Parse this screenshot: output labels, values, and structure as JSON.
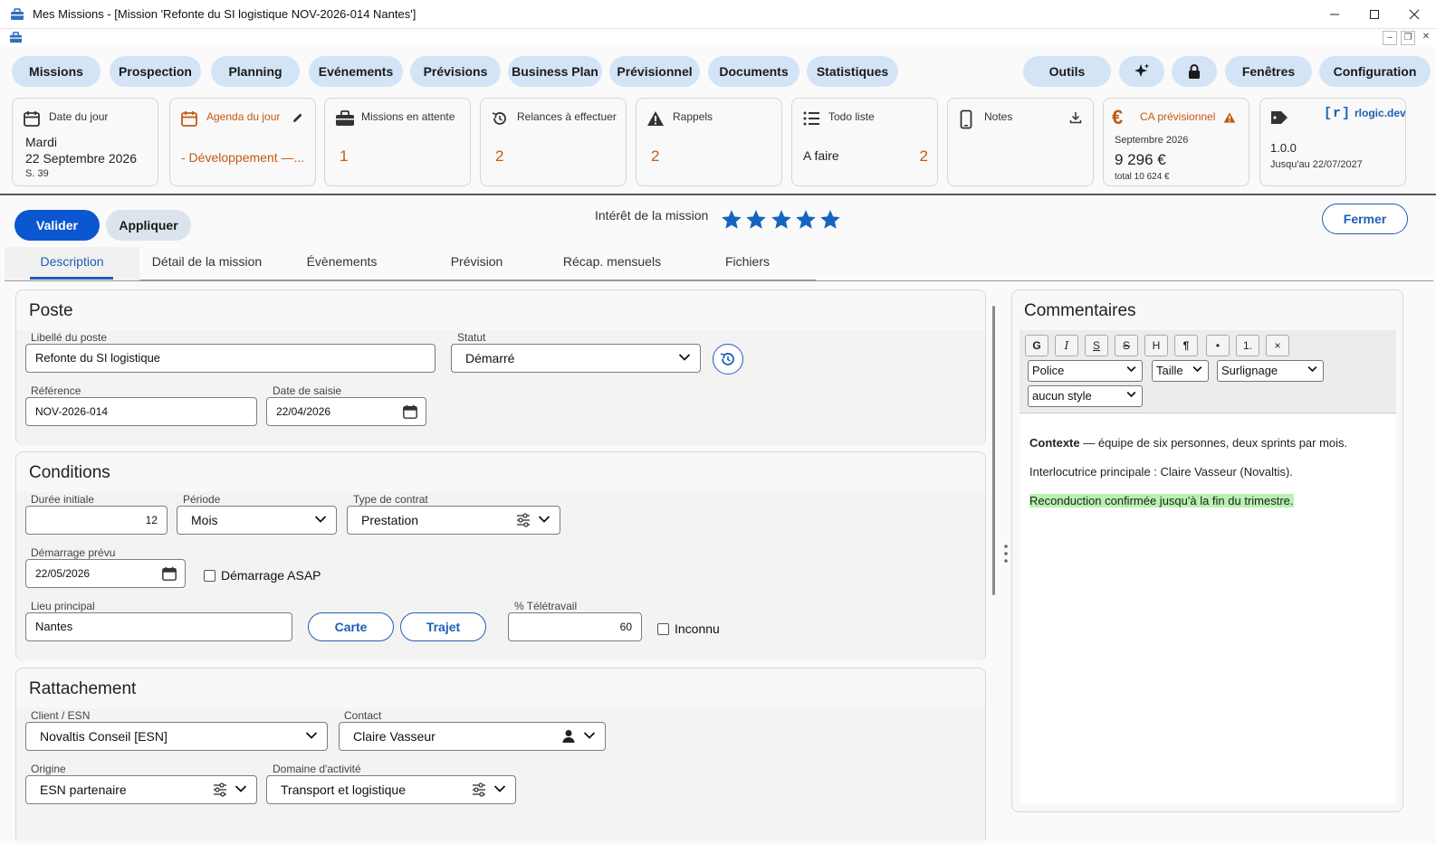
{
  "window": {
    "title": "Mes Missions - [Mission 'Refonte du SI logistique NOV-2026-014 Nantes']"
  },
  "menu": {
    "left": [
      "Missions",
      "Prospection",
      "Planning",
      "Evénements",
      "Prévisions",
      "Business Plan",
      "Prévisionnel",
      "Documents",
      "Statistiques"
    ],
    "right": [
      "Outils",
      "Fenêtres",
      "Configuration"
    ]
  },
  "dashboard": {
    "date": {
      "title": "Date du jour",
      "day": "Mardi",
      "date": "22 Septembre 2026",
      "week": "S. 39"
    },
    "agenda": {
      "title": "Agenda du jour",
      "value": "- Développement —..."
    },
    "missions": {
      "title": "Missions en attente",
      "value": "1"
    },
    "relances": {
      "title": "Relances à effectuer",
      "value": "2"
    },
    "rappels": {
      "title": "Rappels",
      "value": "2"
    },
    "todo": {
      "title": "Todo liste",
      "label": "A faire",
      "value": "2"
    },
    "notes": {
      "title": "Notes"
    },
    "ca": {
      "title": "CA prévisionnel",
      "period": "Septembre 2026",
      "amount": "9 296 €",
      "total": "total 10 624 €"
    },
    "version": {
      "brand": "rlogic.dev",
      "version": "1.0.0",
      "until": "Jusqu'au 22/07/2027"
    }
  },
  "actions": {
    "validate": "Valider",
    "apply": "Appliquer",
    "close": "Fermer"
  },
  "interest": {
    "label": "Intérêt de la mission",
    "stars": 5,
    "max": 5
  },
  "tabs": [
    "Description",
    "Détail de la mission",
    "Évènements",
    "Prévision",
    "Récap. mensuels",
    "Fichiers"
  ],
  "poste": {
    "title": "Poste",
    "libelle_label": "Libellé du poste",
    "libelle": "Refonte du SI logistique",
    "statut_label": "Statut",
    "statut": "Démarré",
    "reference_label": "Référence",
    "reference": "NOV-2026-014",
    "date_saisie_label": "Date de saisie",
    "date_saisie": "22/04/2026"
  },
  "conditions": {
    "title": "Conditions",
    "duree_label": "Durée initiale",
    "duree": "12",
    "periode_label": "Période",
    "periode": "Mois",
    "contrat_label": "Type de contrat",
    "contrat": "Prestation",
    "demarrage_label": "Démarrage prévu",
    "demarrage": "22/05/2026",
    "asap_label": "Démarrage ASAP",
    "lieu_label": "Lieu principal",
    "lieu": "Nantes",
    "carte": "Carte",
    "trajet": "Trajet",
    "teletravail_label": "% Télétravail",
    "teletravail": "60",
    "inconnu_label": "Inconnu"
  },
  "rattachement": {
    "title": "Rattachement",
    "client_label": "Client / ESN",
    "client": "Novaltis Conseil [ESN]",
    "contact_label": "Contact",
    "contact": "Claire Vasseur",
    "origine_label": "Origine",
    "origine": "ESN partenaire",
    "domaine_label": "Domaine d'activité",
    "domaine": "Transport et logistique"
  },
  "comments": {
    "title": "Commentaires",
    "toolbar": [
      "G",
      "I",
      "S",
      "S",
      "H",
      "¶",
      "•",
      "1.",
      "×"
    ],
    "font": "Police",
    "size": "Taille",
    "highlight": "Surlignage",
    "style": "aucun style",
    "line1_bold": "Contexte",
    "line1_rest": " — équipe de six personnes, deux sprints par mois.",
    "line2": "Interlocutrice principale : Claire Vasseur (Novaltis).",
    "line3": "Reconduction confirmée jusqu'à la fin du trimestre."
  },
  "colors": {
    "accent": "#0b57d0",
    "pill": "#d4e4f7",
    "orange": "#c55a11",
    "highlight": "#b8f2b0",
    "star": "#1565c0"
  }
}
